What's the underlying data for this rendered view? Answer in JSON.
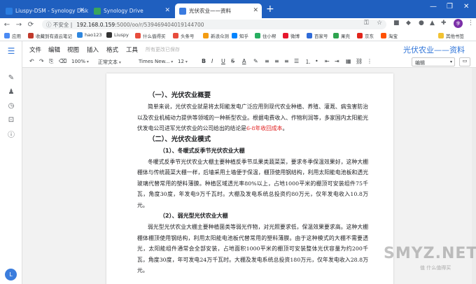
{
  "browser": {
    "tabs": [
      {
        "title": "Liuspy-DSM - Synology DiskStation",
        "active": false,
        "favicon_color": "#2a7de1"
      },
      {
        "title": "Synology Drive",
        "active": false,
        "favicon_color": "#3aa55c"
      },
      {
        "title": "光伏农业——资料",
        "active": true,
        "favicon_color": "#3a7be0"
      }
    ],
    "new_tab": "+",
    "window_controls": [
      "—",
      "❐",
      "✕"
    ],
    "address": {
      "security_label": "不安全",
      "url_host": "192.168.0.159",
      "url_rest": ":5000/oo/r/539469404019144700"
    },
    "profile_initial": "李",
    "bookmarks": [
      {
        "label": "应用",
        "color": "#4a8af4"
      },
      {
        "label": "收藏到有道云笔记",
        "color": "#c0392b"
      },
      {
        "label": "hao123",
        "color": "#2e86de"
      },
      {
        "label": "Liuspy",
        "color": "#333333"
      },
      {
        "label": "什么值得买",
        "color": "#e74c3c"
      },
      {
        "label": "头条号",
        "color": "#e74c3c"
      },
      {
        "label": "新浪众测",
        "color": "#f39c12"
      },
      {
        "label": "知乎",
        "color": "#0084ff"
      },
      {
        "label": "住小帮",
        "color": "#27ae60"
      },
      {
        "label": "微博",
        "color": "#e6162d"
      },
      {
        "label": "百家号",
        "color": "#2f6bd8"
      },
      {
        "label": "果壳",
        "color": "#2ea44f"
      },
      {
        "label": "京东",
        "color": "#e1251b"
      },
      {
        "label": "淘宝",
        "color": "#ff5000"
      },
      {
        "label": "其他书签",
        "color": "#f1c232"
      }
    ]
  },
  "app": {
    "menu": [
      "文件",
      "编辑",
      "视图",
      "插入",
      "格式",
      "工具"
    ],
    "save_status": "所有更改已保存",
    "doc_title": "光伏农业——资料",
    "toolbar": {
      "undo": "↶",
      "redo": "↷",
      "paint": "⎘",
      "clear": "⌫",
      "zoom": "100%",
      "style": "正常文本",
      "font": "Times New...",
      "size": "12",
      "bold": "B",
      "italic": "I",
      "underline": "U",
      "strike": "S",
      "color": "A",
      "highlight": "✎",
      "link": "🔗",
      "more": "⋮",
      "mode": "编辑",
      "layout": "▭"
    },
    "user_initial": "L"
  },
  "document": {
    "h1_overview": "（一）、光伏农业概要",
    "p_overview_pre": "简单来说，光伏农业就是将太阳能发电广泛应用到现代农业种植、养殖、灌溉、病虫害防治以及农业机械动力提供等领域的一种新型农业。根据电费收入、作物利润等，多家国内太阳能光伏发电公司进军光伏农业的公司给出的结论是",
    "p_overview_red": "6-8年收回成本",
    "p_overview_post": "。",
    "h1_modes": "（二）、光伏农业模式",
    "h2_winter": "（1）、冬暖式反季节光伏农业大棚",
    "p_winter": "冬暖式反季节光伏农业大棚主要种植反季节瓜果类蔬菜菜，要求冬季保温效果好，这种大棚棚体与传统蔬菜大棚一样，后墙采用土墙便于保温，棚顶使用钢结构，利用太阳能电池板和透光玻璃代替常用的塑料薄膜。种植区域透光率80%以上，占地1000平米的棚顶可安装组件75千瓦，角度30度，年发电9万千瓦时。大棚及发电系统总投资约80万元，仅年发电收入10.8万元。",
    "h2_weak": "（2）、弱光型光伏农业大棚",
    "p_weak": "弱光型光伏农业大棚主要种植菌类等弱光作物，对光照要求低，保温效果要求高。这种大棚棚体棚顶使用钢结构，利用太阳能电池板代替常用的塑料薄膜。由于这种模式的大棚不需要透光，太阳能组件通常会全部安装，占地面积1000平米的棚顶可安装整体光伏容量为约200千瓦，角度30度，年可发电24万千瓦时。大棚及发电系统总投资180万元，仅年发电收入28.8万元。"
  },
  "watermark": "SMYZ.NET",
  "watermark_sub": "值 什么值得买"
}
